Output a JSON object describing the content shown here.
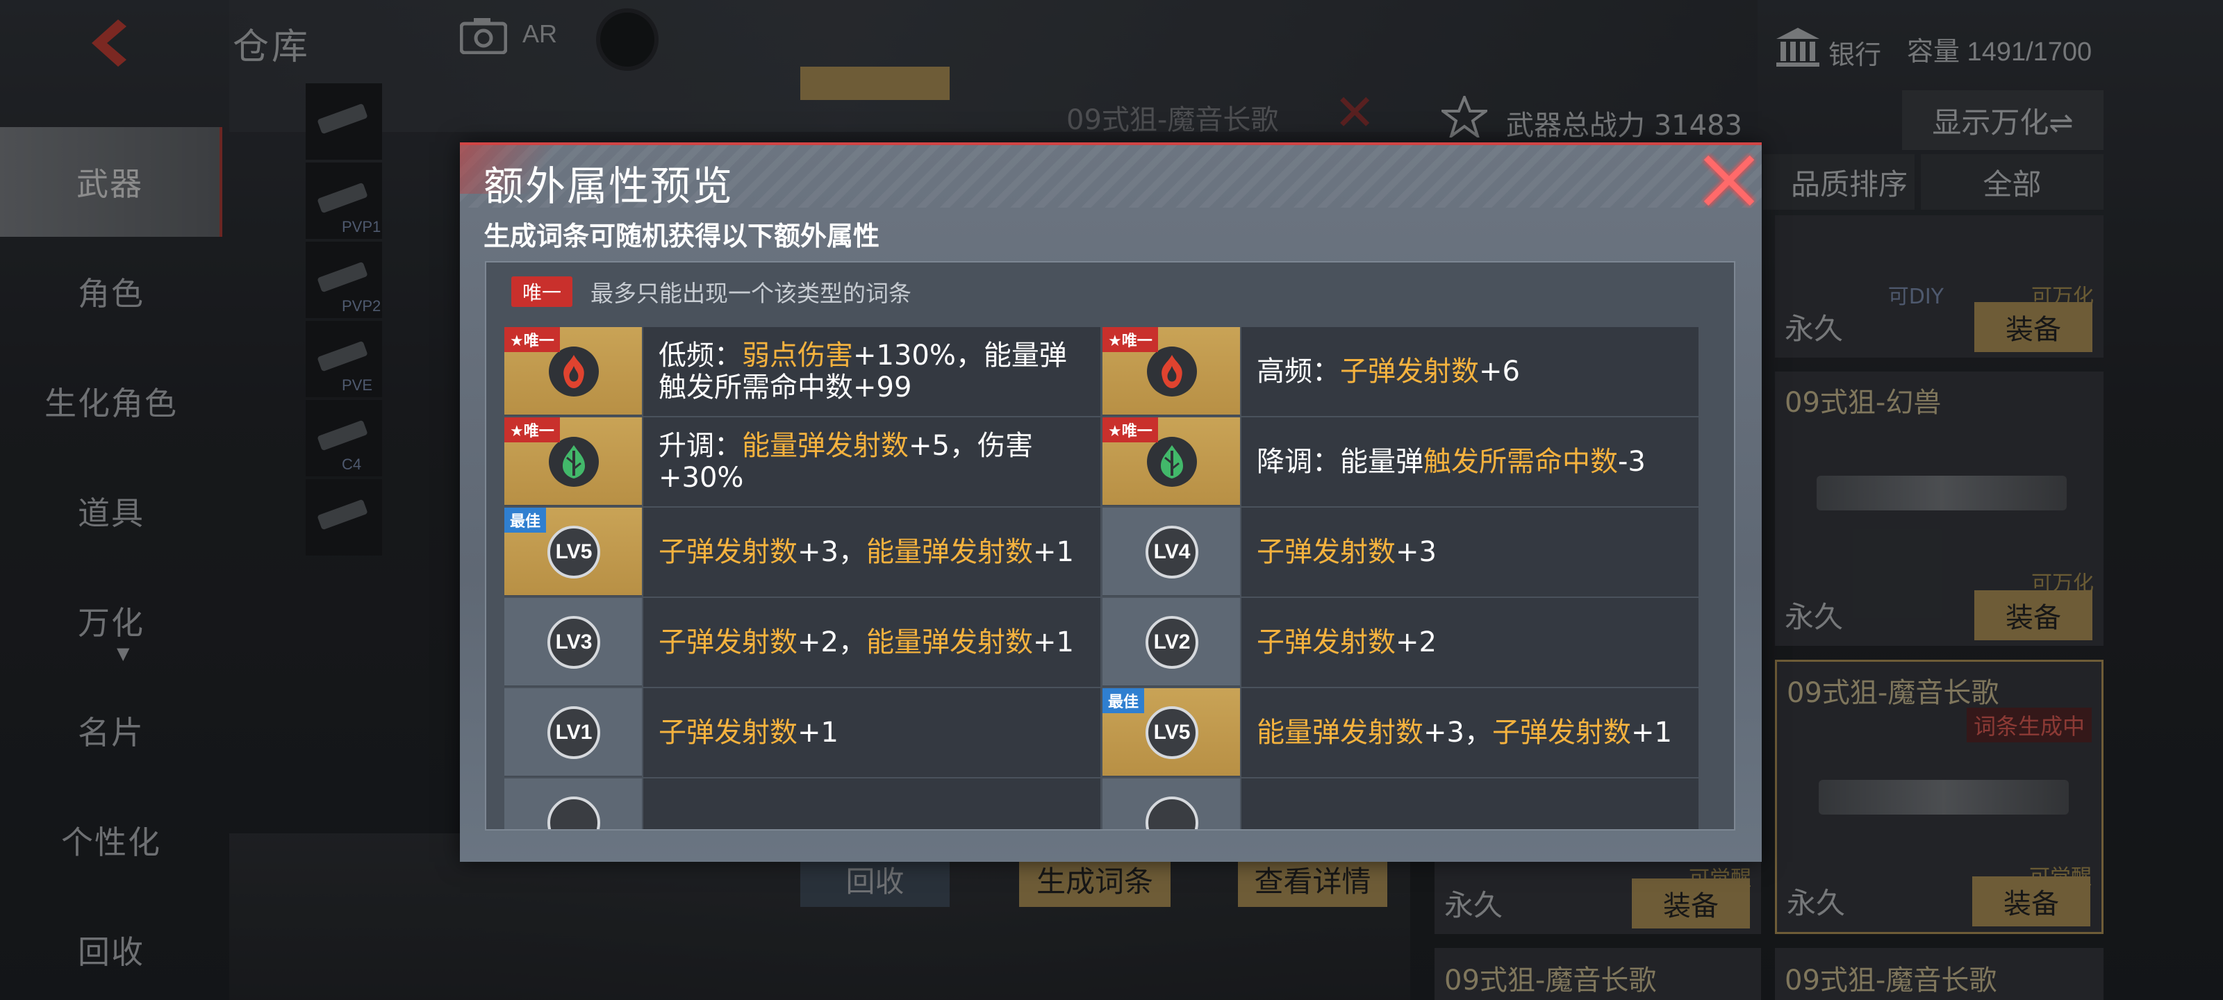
{
  "header": {
    "page_title": "仓库",
    "ar_label": "AR",
    "bank_label": "银行",
    "capacity": "容量 1491/1700"
  },
  "sidebar": {
    "items": [
      {
        "label": "武器",
        "active": true
      },
      {
        "label": "角色",
        "active": false
      },
      {
        "label": "生化角色",
        "active": false
      },
      {
        "label": "道具",
        "active": false
      },
      {
        "label": "万化",
        "active": false,
        "has_dropdown": true
      },
      {
        "label": "名片",
        "active": false
      },
      {
        "label": "个性化",
        "active": false
      },
      {
        "label": "回收",
        "active": false
      }
    ],
    "dropdown_arrow": "▼"
  },
  "thumbs": [
    {
      "tag": ""
    },
    {
      "tag": "PVP1"
    },
    {
      "tag": "PVP2"
    },
    {
      "tag": "PVE"
    },
    {
      "tag": "C4"
    },
    {
      "tag": ""
    }
  ],
  "background_panel": {
    "weapon_title": "09式狙-魔音长歌",
    "power_label": "武器总战力",
    "power_value": "31483",
    "show_toggle": "显示万化⇌",
    "sort_label": "品质排序",
    "filter_label": "全部",
    "bottom_buttons": [
      "回收",
      "生成词条",
      "查看详情"
    ],
    "cards": [
      {
        "name": "",
        "tag1": "可DIY",
        "tag2": "可万化",
        "perm": "永久",
        "equip": "装备"
      },
      {
        "name": "09式狙-幻兽",
        "tag1": "",
        "tag2": "可万化",
        "perm": "永久",
        "equip": "装备"
      },
      {
        "name": "09式狙-魔音长歌",
        "badge": "词条生成中",
        "tag2": "可觉醒",
        "perm": "永久",
        "equip": "装备"
      },
      {
        "name": "",
        "tag2": "可觉醒",
        "perm": "永久",
        "equip": "装备"
      }
    ],
    "bottom_card_names": [
      "09式狙-魔音长歌",
      "09式狙-魔音长歌"
    ]
  },
  "dialog": {
    "title": "额外属性预览",
    "subtitle": "生成词条可随机获得以下额外属性",
    "legend_tag": "唯一",
    "legend_text": "最多只能出现一个该类型的词条",
    "unique_corner": "★唯一",
    "best_corner": "最佳",
    "rows": [
      [
        {
          "icon": "fire",
          "color": "#e0432f",
          "gold": true,
          "corner": "★唯一",
          "parts": [
            [
              "",
              "低频："
            ],
            [
              "hl",
              "弱点伤害"
            ],
            [
              "",
              "+130%，能量弹触发所需命中数+99"
            ]
          ]
        },
        {
          "icon": "fire",
          "color": "#e0432f",
          "gold": true,
          "corner": "★唯一",
          "parts": [
            [
              "",
              "高频："
            ],
            [
              "hl",
              "子弹发射数"
            ],
            [
              "",
              "+6"
            ]
          ]
        }
      ],
      [
        {
          "icon": "leaf",
          "color": "#42b86a",
          "gold": true,
          "corner": "★唯一",
          "parts": [
            [
              "",
              "升调："
            ],
            [
              "hl",
              "能量弹发射数"
            ],
            [
              "",
              "+5，伤害+30%"
            ]
          ]
        },
        {
          "icon": "leaf",
          "color": "#42b86a",
          "gold": true,
          "corner": "★唯一",
          "parts": [
            [
              "",
              "降调：能量弹"
            ],
            [
              "hl",
              "触发所需命中数"
            ],
            [
              "",
              "-3"
            ]
          ]
        }
      ],
      [
        {
          "icon": "lv",
          "lv": "LV5",
          "gold": true,
          "corner": "最佳",
          "parts": [
            [
              "hl",
              "子弹发射数"
            ],
            [
              "",
              "+3，"
            ],
            [
              "hl",
              "能量弹发射数"
            ],
            [
              "",
              "+1"
            ]
          ]
        },
        {
          "icon": "lv",
          "lv": "LV4",
          "gold": false,
          "corner": "",
          "parts": [
            [
              "hl",
              "子弹发射数"
            ],
            [
              "",
              "+3"
            ]
          ]
        }
      ],
      [
        {
          "icon": "lv",
          "lv": "LV3",
          "gold": false,
          "corner": "",
          "parts": [
            [
              "hl",
              "子弹发射数"
            ],
            [
              "",
              "+2，"
            ],
            [
              "hl",
              "能量弹发射数"
            ],
            [
              "",
              "+1"
            ]
          ]
        },
        {
          "icon": "lv",
          "lv": "LV2",
          "gold": false,
          "corner": "",
          "parts": [
            [
              "hl",
              "子弹发射数"
            ],
            [
              "",
              "+2"
            ]
          ]
        }
      ],
      [
        {
          "icon": "lv",
          "lv": "LV1",
          "gold": false,
          "corner": "",
          "parts": [
            [
              "hl",
              "子弹发射数"
            ],
            [
              "",
              "+1"
            ]
          ]
        },
        {
          "icon": "lv",
          "lv": "LV5",
          "gold": true,
          "corner": "最佳",
          "parts": [
            [
              "hl",
              "能量弹发射数"
            ],
            [
              "",
              "+3，"
            ],
            [
              "hl",
              "子弹发射数"
            ],
            [
              "",
              "+1"
            ]
          ]
        }
      ],
      [
        {
          "icon": "lv",
          "lv": "",
          "gold": false,
          "corner": "",
          "parts": []
        },
        {
          "icon": "lv",
          "lv": "",
          "gold": false,
          "corner": "",
          "parts": []
        }
      ]
    ]
  },
  "colors": {
    "accent_red": "#c9302c",
    "highlight": "#f5b23e",
    "gold": "#c9a356",
    "best_blue": "#2f7fd0"
  }
}
